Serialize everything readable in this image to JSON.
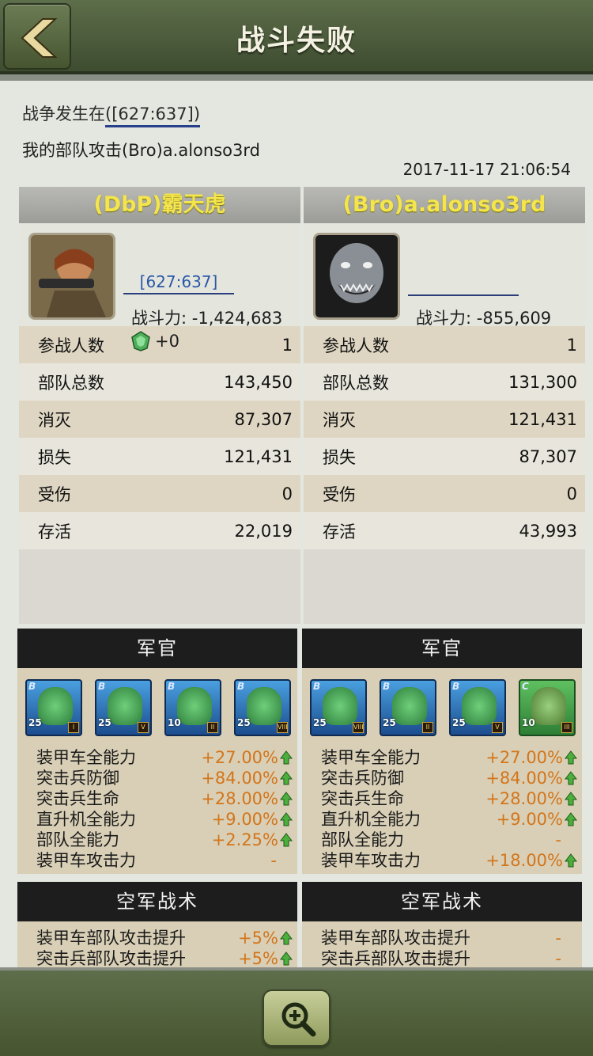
{
  "header": {
    "title": "战斗失败"
  },
  "info": {
    "location_prefix": "战争发生在",
    "location_link": "([627:637])",
    "description": "我的部队攻击(Bro)a.alonso3rd",
    "timestamp": "2017-11-17  21:06:54"
  },
  "left": {
    "name": "(DbP)霸天虎",
    "coord": "[627:637]",
    "power": "战斗力: -1,424,683",
    "gem_value": "+0",
    "stats": [
      {
        "label": "参战人数",
        "value": "1"
      },
      {
        "label": "部队总数",
        "value": "143,450"
      },
      {
        "label": "消灭",
        "value": "87,307"
      },
      {
        "label": "损失",
        "value": "121,431"
      },
      {
        "label": "受伤",
        "value": "0"
      },
      {
        "label": "存活",
        "value": "22,019"
      }
    ],
    "officers_title": "军官",
    "officers": [
      {
        "rank": "B",
        "level": "25",
        "badge": "I"
      },
      {
        "rank": "B",
        "level": "25",
        "badge": "V"
      },
      {
        "rank": "B",
        "level": "10",
        "badge": "II"
      },
      {
        "rank": "B",
        "level": "25",
        "badge": "VIII"
      }
    ],
    "buffs": [
      {
        "label": "装甲车全能力",
        "value": "+27.00%",
        "arrow": true
      },
      {
        "label": "突击兵防御",
        "value": "+84.00%",
        "arrow": true
      },
      {
        "label": "突击兵生命",
        "value": "+28.00%",
        "arrow": true
      },
      {
        "label": "直升机全能力",
        "value": "+9.00%",
        "arrow": true
      },
      {
        "label": "部队全能力",
        "value": "+2.25%",
        "arrow": true
      },
      {
        "label": "装甲车攻击力",
        "value": "-",
        "arrow": false
      }
    ],
    "air_title": "空军战术",
    "air": [
      {
        "label": "装甲车部队攻击提升",
        "value": "+5%",
        "arrow": true
      },
      {
        "label": "突击兵部队攻击提升",
        "value": "+5%",
        "arrow": true
      }
    ]
  },
  "right": {
    "name": "(Bro)a.alonso3rd",
    "coord": "",
    "power": "战斗力: -855,609",
    "stats": [
      {
        "label": "参战人数",
        "value": "1"
      },
      {
        "label": "部队总数",
        "value": "131,300"
      },
      {
        "label": "消灭",
        "value": "121,431"
      },
      {
        "label": "损失",
        "value": "87,307"
      },
      {
        "label": "受伤",
        "value": "0"
      },
      {
        "label": "存活",
        "value": "43,993"
      }
    ],
    "officers_title": "军官",
    "officers": [
      {
        "rank": "B",
        "level": "25",
        "badge": "VIII"
      },
      {
        "rank": "B",
        "level": "25",
        "badge": "II"
      },
      {
        "rank": "B",
        "level": "25",
        "badge": "V"
      },
      {
        "rank": "C",
        "level": "10",
        "badge": "III"
      }
    ],
    "buffs": [
      {
        "label": "装甲车全能力",
        "value": "+27.00%",
        "arrow": true
      },
      {
        "label": "突击兵防御",
        "value": "+84.00%",
        "arrow": true
      },
      {
        "label": "突击兵生命",
        "value": "+28.00%",
        "arrow": true
      },
      {
        "label": "直升机全能力",
        "value": "+9.00%",
        "arrow": true
      },
      {
        "label": "部队全能力",
        "value": "-",
        "arrow": false
      },
      {
        "label": "装甲车攻击力",
        "value": "+18.00%",
        "arrow": true
      }
    ],
    "air_title": "空军战术",
    "air": [
      {
        "label": "装甲车部队攻击提升",
        "value": "-",
        "arrow": false
      },
      {
        "label": "突击兵部队攻击提升",
        "value": "-",
        "arrow": false
      }
    ]
  },
  "colors": {
    "header": "#4d5d3b",
    "name": "#f4e44d",
    "buff_value": "#d4751a",
    "coord": "#2a57a8"
  },
  "icons": {
    "back": "back-arrow-icon",
    "zoom": "zoom-in-icon",
    "gem": "gem-icon",
    "buff_arrow": "up-arrow-icon"
  }
}
